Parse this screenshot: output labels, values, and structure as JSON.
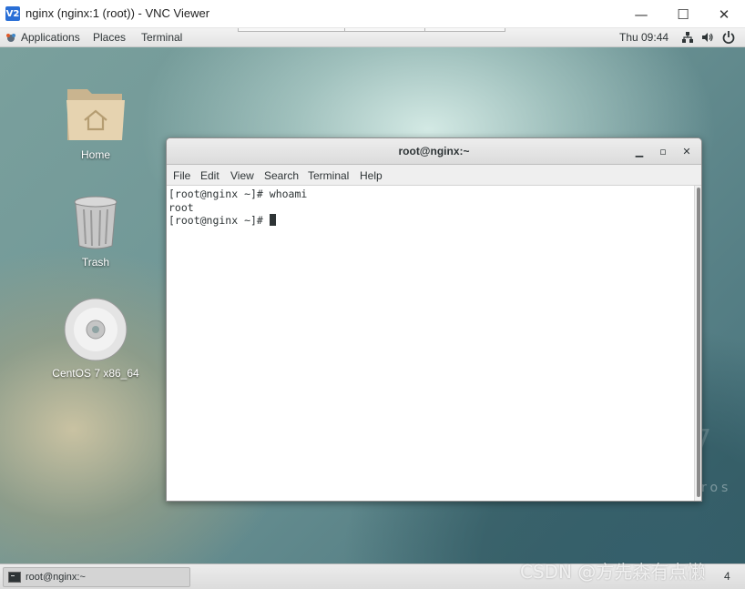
{
  "vnc": {
    "logo_text": "V2",
    "title": "nginx (nginx:1 (root)) - VNC Viewer",
    "minimize": "—",
    "maximize": "☐",
    "close": "✕"
  },
  "panel": {
    "applications": "Applications",
    "places": "Places",
    "terminal": "Terminal",
    "clock": "Thu 09:44",
    "icons": [
      "network-icon",
      "volume-icon",
      "power-icon"
    ]
  },
  "desktop": {
    "icons": [
      {
        "label": "Home",
        "icon": "home-folder-icon"
      },
      {
        "label": "Trash",
        "icon": "trash-icon"
      },
      {
        "label": "CentOS 7 x86_64",
        "icon": "cd-icon"
      }
    ],
    "brand_digit": "7",
    "brand_text": "ros"
  },
  "terminal": {
    "title": "root@nginx:~",
    "menu": [
      "File",
      "Edit",
      "View",
      "Search",
      "Terminal",
      "Help"
    ],
    "lines": [
      "[root@nginx ~]# whoami",
      "root",
      "[root@nginx ~]# "
    ]
  },
  "taskbar": {
    "item_label": "root@nginx:~",
    "workspace": "4"
  },
  "watermark": "CSDN @方先森有点懒"
}
